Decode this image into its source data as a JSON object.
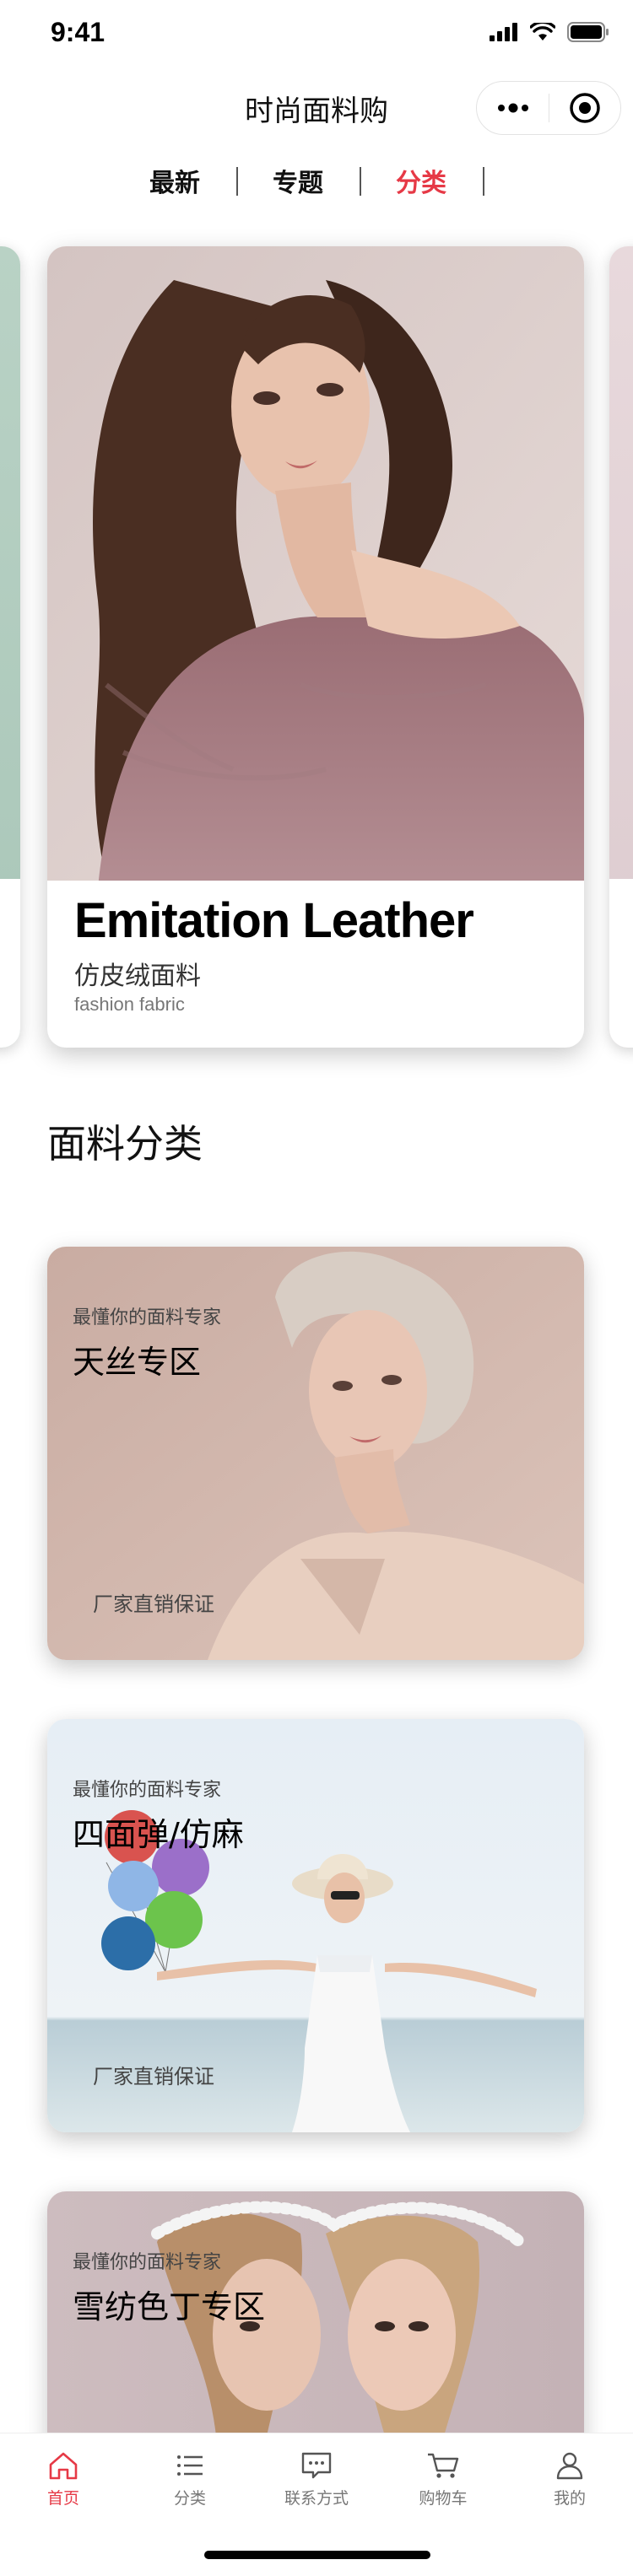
{
  "status_bar": {
    "time": "9:41"
  },
  "nav": {
    "title": "时尚面料购"
  },
  "tabs": [
    {
      "label": "最新",
      "active": false
    },
    {
      "label": "专题",
      "active": false
    },
    {
      "label": "分类",
      "active": true
    }
  ],
  "hero": {
    "title_en": "Emitation Leather",
    "title_cn": "仿皮绒面料",
    "subtitle": "fashion fabric"
  },
  "section": {
    "title": "面料分类"
  },
  "categories": [
    {
      "tagline": "最懂你的面料专家",
      "title": "天丝专区",
      "footer": "厂家直销保证"
    },
    {
      "tagline": "最懂你的面料专家",
      "title": "四面弹/仿麻",
      "footer": "厂家直销保证"
    },
    {
      "tagline": "最懂你的面料专家",
      "title": "雪纺色丁专区",
      "footer": ""
    }
  ],
  "tabbar": [
    {
      "label": "首页",
      "icon": "home-icon",
      "active": true
    },
    {
      "label": "分类",
      "icon": "list-icon",
      "active": false
    },
    {
      "label": "联系方式",
      "icon": "chat-icon",
      "active": false
    },
    {
      "label": "购物车",
      "icon": "cart-icon",
      "active": false
    },
    {
      "label": "我的",
      "icon": "user-icon",
      "active": false
    }
  ],
  "colors": {
    "accent": "#e63946",
    "text": "#111111",
    "muted": "#777777"
  }
}
